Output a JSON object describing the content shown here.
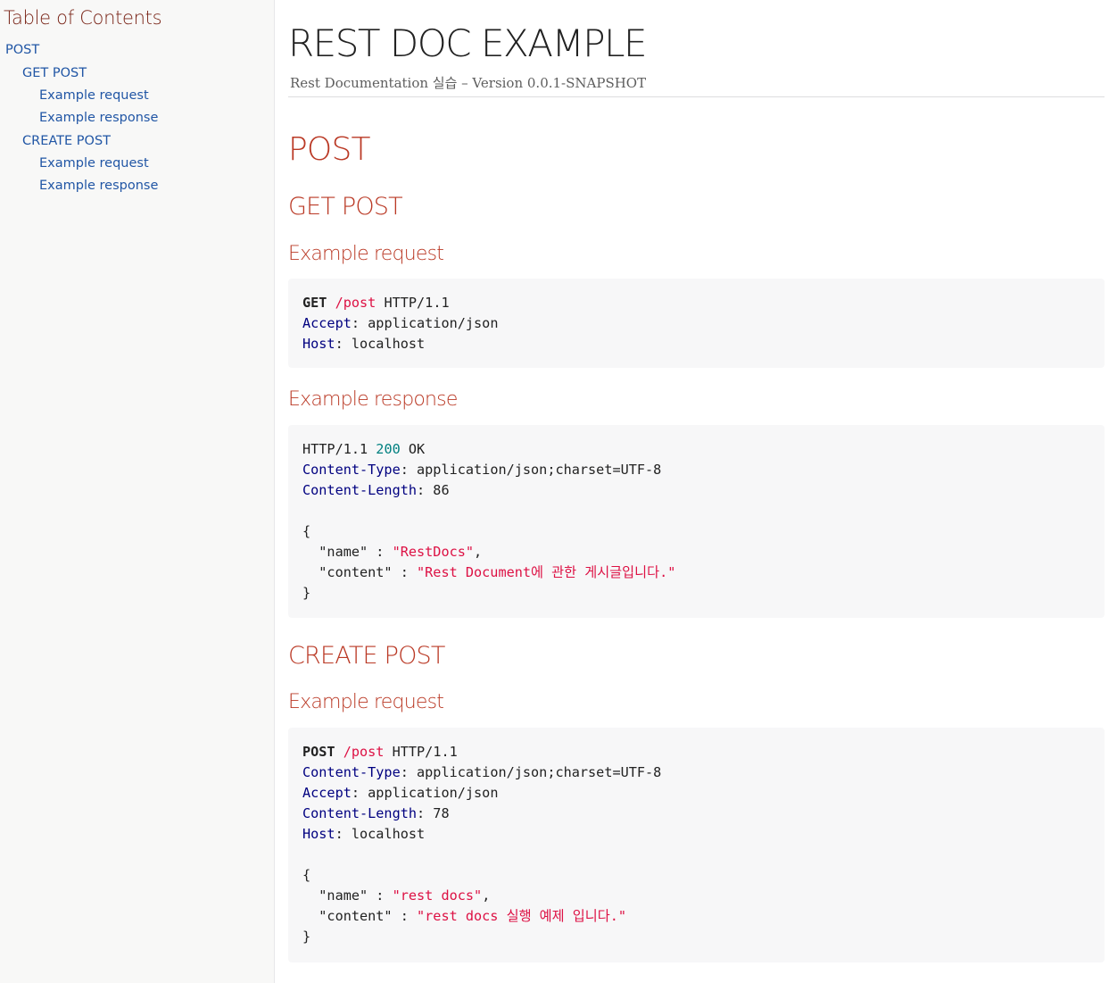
{
  "toc": {
    "title": "Table of Contents",
    "items": [
      {
        "label": "POST"
      },
      {
        "label": "GET POST"
      },
      {
        "label": "Example request"
      },
      {
        "label": "Example response"
      },
      {
        "label": "CREATE POST"
      },
      {
        "label": "Example request"
      },
      {
        "label": "Example response"
      }
    ]
  },
  "header": {
    "title": "REST DOC EXAMPLE",
    "details": "Rest Documentation 실습 – Version 0.0.1-SNAPSHOT"
  },
  "sections": {
    "post": {
      "title": "POST"
    },
    "get_post": {
      "title": "GET POST",
      "request_title": "Example request",
      "request": {
        "method": "GET",
        "path": "/post",
        "protocol": " HTTP/1.1",
        "headers": [
          {
            "name": "Accept",
            "value": ": application/json"
          },
          {
            "name": "Host",
            "value": ": localhost"
          }
        ]
      },
      "response_title": "Example response",
      "response": {
        "protocol": "HTTP/1.1 ",
        "status_code": "200",
        "status_text": " OK",
        "headers": [
          {
            "name": "Content-Type",
            "value": ": application/json;charset=UTF-8"
          },
          {
            "name": "Content-Length",
            "value": ": 86"
          }
        ],
        "body_open": "{",
        "fields": [
          {
            "key": "  \"name\" : ",
            "value": "\"RestDocs\"",
            "suffix": ","
          },
          {
            "key": "  \"content\" : ",
            "value": "\"Rest Document에 관한 게시글입니다.\"",
            "suffix": ""
          }
        ],
        "body_close": "}"
      }
    },
    "create_post": {
      "title": "CREATE POST",
      "request_title": "Example request",
      "request": {
        "method": "POST",
        "path": "/post",
        "protocol": " HTTP/1.1",
        "headers": [
          {
            "name": "Content-Type",
            "value": ": application/json;charset=UTF-8"
          },
          {
            "name": "Accept",
            "value": ": application/json"
          },
          {
            "name": "Content-Length",
            "value": ": 78"
          },
          {
            "name": "Host",
            "value": ": localhost"
          }
        ],
        "body_open": "{",
        "fields": [
          {
            "key": "  \"name\" : ",
            "value": "\"rest docs\"",
            "suffix": ","
          },
          {
            "key": "  \"content\" : ",
            "value": "\"rest docs 실행 예제 입니다.\"",
            "suffix": ""
          }
        ],
        "body_close": "}"
      }
    }
  }
}
